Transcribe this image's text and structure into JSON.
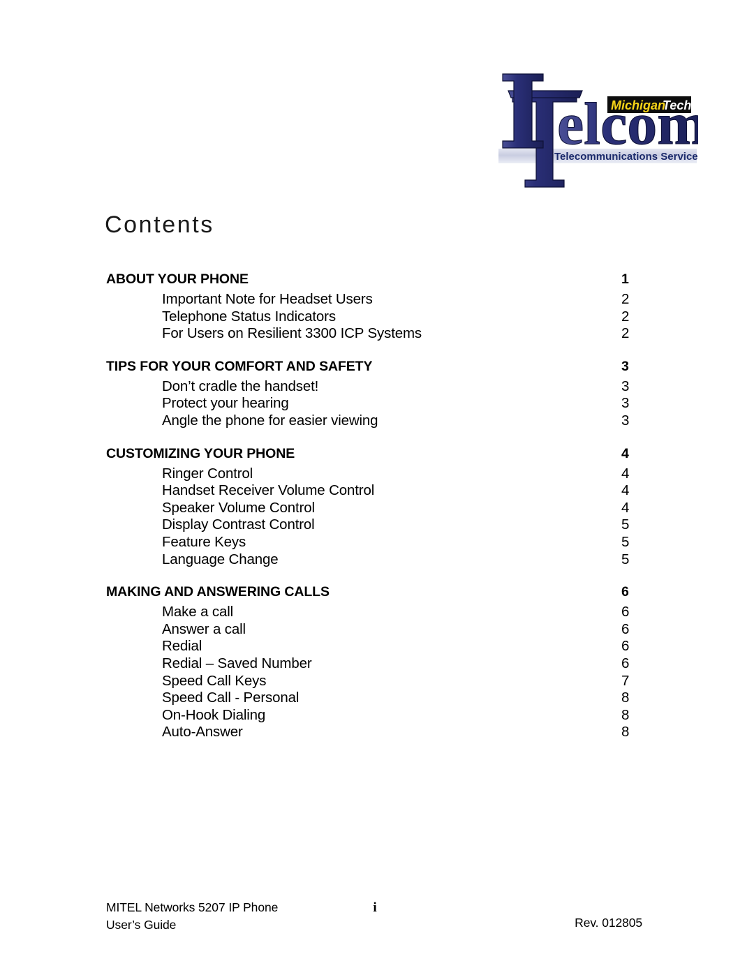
{
  "logo": {
    "brand_mark": "IT",
    "wordmark": "Telcom",
    "badge_part1": "Michigan",
    "badge_part2": "Tech",
    "banner": "Telecommunications Services",
    "colors": {
      "navy": "#272b6e",
      "badge_bg": "#0d0d0d",
      "badge_yellow": "#f7d417",
      "badge_white": "#ffffff",
      "banner_bg": "#cdd0e2",
      "banner_text": "#1b2a6b"
    }
  },
  "page_title": "Contents",
  "toc": {
    "sections": [
      {
        "heading": "ABOUT YOUR PHONE",
        "heading_page": "1",
        "items": [
          {
            "label": "Important Note for Headset Users",
            "page": "2"
          },
          {
            "label": "Telephone Status Indicators",
            "page": "2"
          },
          {
            "label": "For Users on Resilient 3300 ICP Systems",
            "page": "2"
          }
        ]
      },
      {
        "heading": "TIPS FOR YOUR COMFORT AND SAFETY",
        "heading_page": "3",
        "items": [
          {
            "label": "Don’t cradle the handset!",
            "page": "3"
          },
          {
            "label": "Protect your hearing",
            "page": "3"
          },
          {
            "label": "Angle the phone for easier viewing",
            "page": "3"
          }
        ]
      },
      {
        "heading": "CUSTOMIZING YOUR PHONE",
        "heading_page": "4",
        "items": [
          {
            "label": "Ringer Control",
            "page": "4"
          },
          {
            "label": "Handset Receiver Volume Control",
            "page": "4"
          },
          {
            "label": "Speaker Volume Control",
            "page": "4"
          },
          {
            "label": "Display Contrast Control",
            "page": "5"
          },
          {
            "label": "Feature Keys",
            "page": "5"
          },
          {
            "label": "Language Change",
            "page": "5"
          }
        ]
      },
      {
        "heading": "MAKING AND ANSWERING CALLS",
        "heading_page": "6",
        "items": [
          {
            "label": "Make a call",
            "page": "6"
          },
          {
            "label": "Answer a call",
            "page": "6"
          },
          {
            "label": "Redial",
            "page": "6"
          },
          {
            "label": "Redial – Saved Number",
            "page": "6"
          },
          {
            "label": "Speed Call Keys",
            "page": "7"
          },
          {
            "label": "Speed Call - Personal",
            "page": "8"
          },
          {
            "label": "On-Hook Dialing",
            "page": "8"
          },
          {
            "label": "Auto-Answer",
            "page": "8"
          }
        ]
      }
    ]
  },
  "footer": {
    "left_line1": "MITEL Networks 5207 IP Phone",
    "left_line2": "User’s Guide",
    "page_number": "i",
    "revision": "Rev. 012805"
  }
}
